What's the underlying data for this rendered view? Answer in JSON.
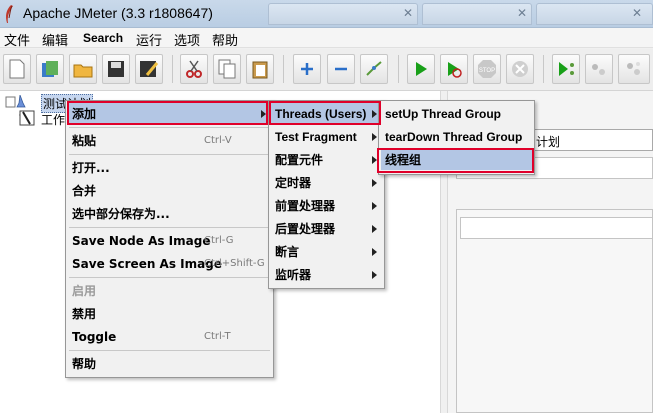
{
  "window": {
    "title": "Apache JMeter (3.3 r1808647)"
  },
  "menubar": [
    "文件",
    "编辑",
    "Search",
    "运行",
    "选项",
    "帮助"
  ],
  "toolbar": {
    "icons": [
      "new-icon",
      "templates-icon",
      "open-icon",
      "save-icon",
      "save-as-icon",
      "cut-icon",
      "copy-icon",
      "paste-icon",
      "expand-icon",
      "collapse-icon",
      "toggle-icon",
      "start-icon",
      "start-no-pause-icon",
      "stop-icon",
      "shutdown-icon",
      "remote-start-icon",
      "clear-icon",
      "clear-all-icon"
    ]
  },
  "tree": {
    "root_label": "测试计划",
    "child_label": "工作"
  },
  "right_pane": {
    "name_value_fragment": "计划"
  },
  "context_menu": {
    "items": [
      {
        "label": "添加",
        "shortcut": "",
        "submenu": true
      },
      {
        "label": "粘贴",
        "shortcut": "Ctrl-V"
      },
      {
        "label": "打开...",
        "shortcut": ""
      },
      {
        "label": "合并",
        "shortcut": ""
      },
      {
        "label": "选中部分保存为...",
        "shortcut": ""
      },
      {
        "label": "Save Node As Image",
        "shortcut": "Ctrl-G"
      },
      {
        "label": "Save Screen As Image",
        "shortcut": "Ctrl+Shift-G"
      },
      {
        "label": "启用",
        "shortcut": "",
        "disabled": true
      },
      {
        "label": "禁用",
        "shortcut": ""
      },
      {
        "label": "Toggle",
        "shortcut": "Ctrl-T"
      },
      {
        "label": "帮助",
        "shortcut": ""
      }
    ]
  },
  "add_submenu": {
    "items": [
      "Threads (Users)",
      "Test Fragment",
      "配置元件",
      "定时器",
      "前置处理器",
      "后置处理器",
      "断言",
      "监听器"
    ]
  },
  "threads_submenu": {
    "items": [
      "setUp Thread Group",
      "tearDown Thread Group",
      "线程组"
    ]
  },
  "colors": {
    "highlight": "#b3c6e4",
    "annotation": "#e0002a"
  }
}
